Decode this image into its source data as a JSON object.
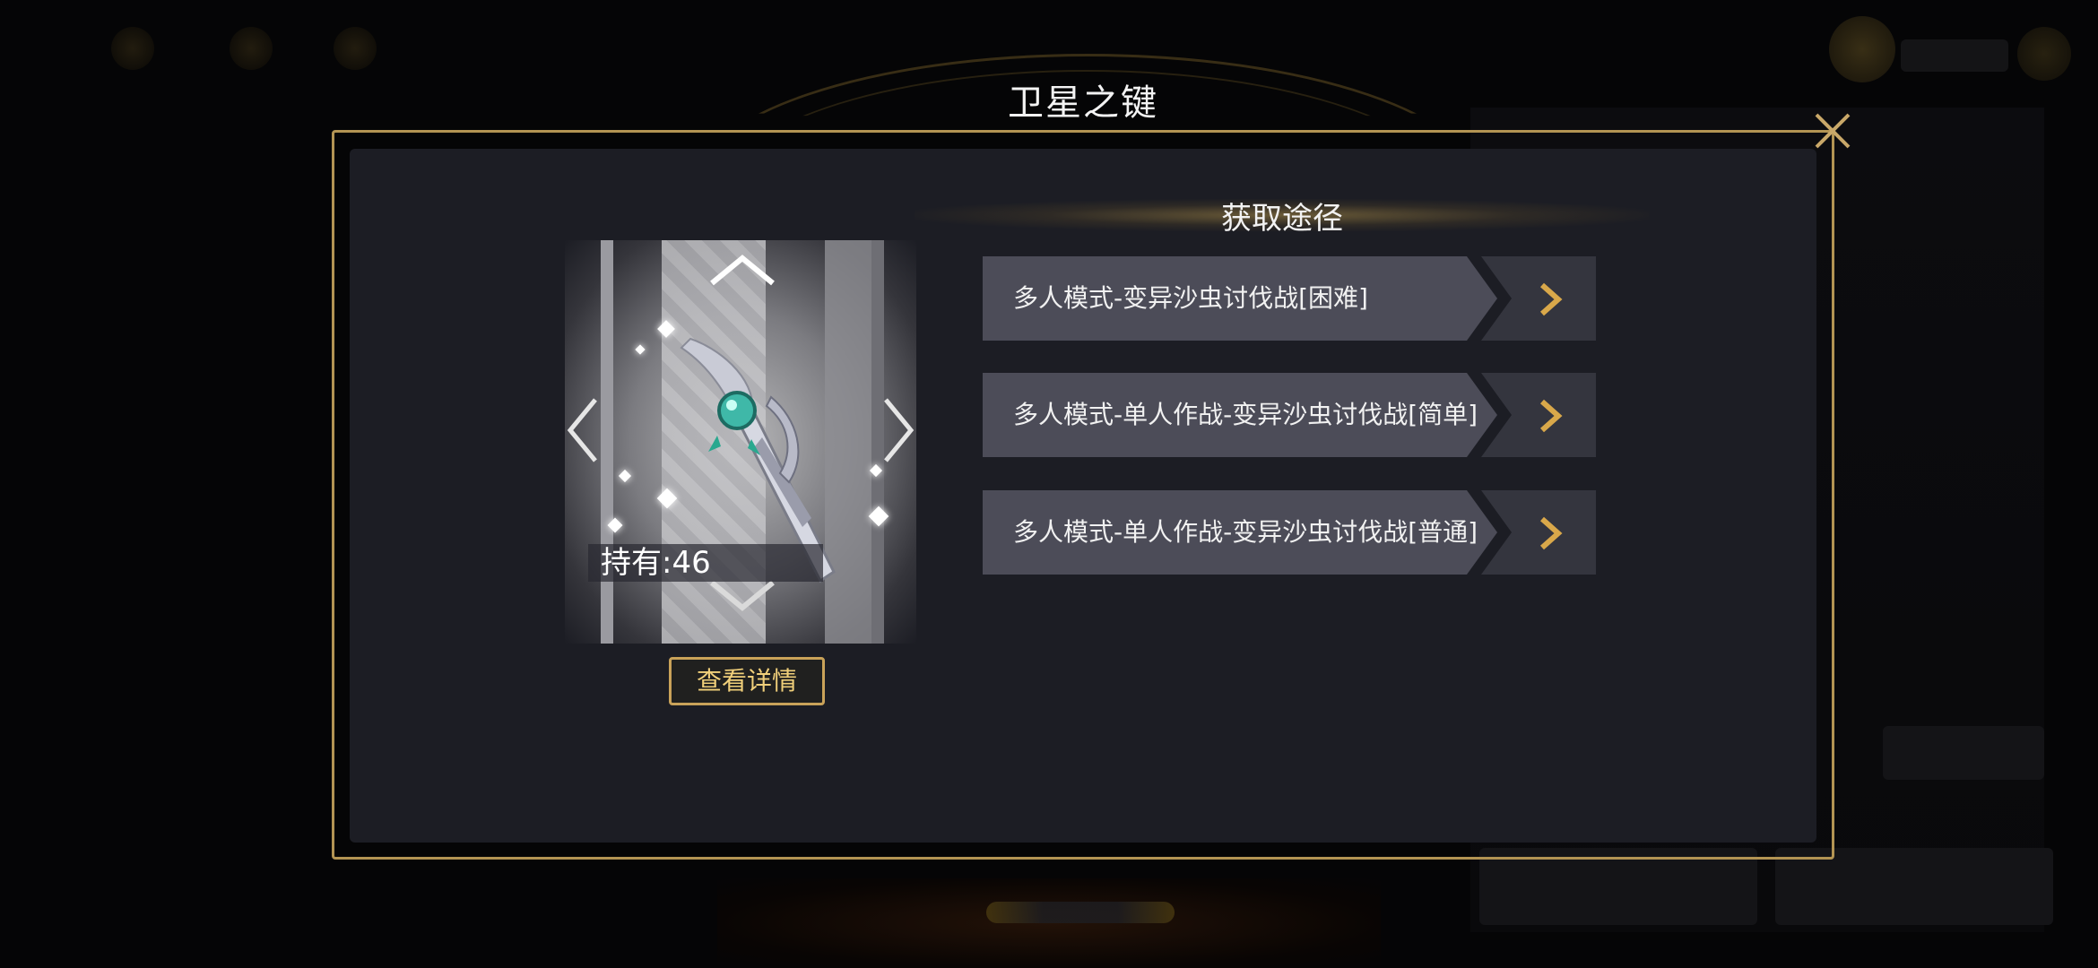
{
  "dialog": {
    "title": "卫星之键",
    "close_icon": "close-icon"
  },
  "item": {
    "owned_text": "持有:46",
    "detail_button": "查看详情",
    "icon": "satellite-key-weapon"
  },
  "acquisition": {
    "title": "获取途径",
    "routes": [
      {
        "label": "多人模式-变异沙虫讨伐战[困难]"
      },
      {
        "label": "多人模式-单人作战-变异沙虫讨伐战[简单]"
      },
      {
        "label": "多人模式-单人作战-变异沙虫讨伐战[普通]"
      }
    ]
  },
  "colors": {
    "gold": "#b39453",
    "gold_text": "#f0cf7a",
    "panel": "#1c1d24",
    "route_body": "#4c4c58",
    "route_cap": "#34353e"
  }
}
